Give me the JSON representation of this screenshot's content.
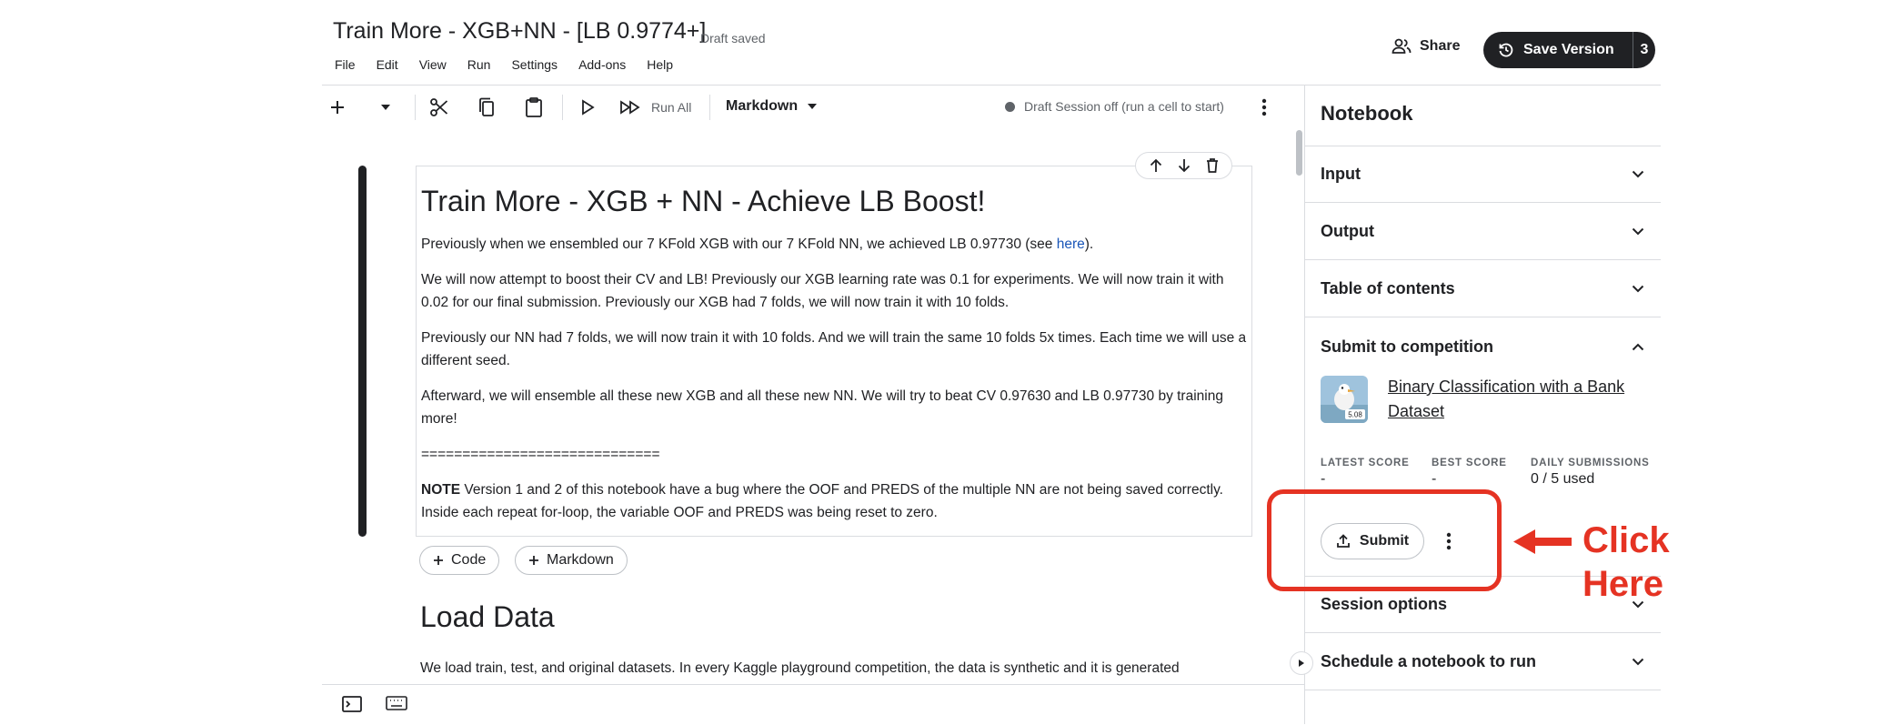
{
  "header": {
    "title": "Train More - XGB+NN - [LB 0.9774+]",
    "draft_status": "Draft saved",
    "menu": [
      "File",
      "Edit",
      "View",
      "Run",
      "Settings",
      "Add-ons",
      "Help"
    ],
    "share_label": "Share",
    "save_version_label": "Save Version",
    "save_version_count": "3"
  },
  "toolbar": {
    "run_all_label": "Run All",
    "cell_type": "Markdown",
    "session_status": "Draft Session off (run a cell to start)",
    "icons": [
      "plus-icon",
      "chevron-down-icon",
      "scissors-icon",
      "copy-icon",
      "paste-icon",
      "run-icon",
      "run-all-icon",
      "more-vert-icon"
    ]
  },
  "cell": {
    "heading": "Train More - XGB + NN - Achieve LB Boost!",
    "p1_before_link": "Previously when we ensembled our 7 KFold XGB with our 7 KFold NN, we achieved LB 0.97730 (see ",
    "p1_link": "here",
    "p1_after_link": ").",
    "p2": "We will now attempt to boost their CV and LB! Previously our XGB learning rate was 0.1 for experiments. We will now train it with 0.02 for our final submission. Previously our XGB had 7 folds, we will now train it with 10 folds.",
    "p3": "Previously our NN had 7 folds, we will now train it with 10 folds. And we will train the same 10 folds 5x times. Each time we will use a different seed.",
    "p4": "Afterward, we will ensemble all these new XGB and all these new NN. We will try to beat CV 0.97630 and LB 0.97730 by training more!",
    "separator": "=============================",
    "note_bold": "NOTE",
    "note_text": " Version 1 and 2 of this notebook have a bug where the OOF and PREDS of the multiple NN are not being saved correctly. Inside each repeat for-loop, the variable OOF and PREDS was being reset to zero."
  },
  "add_cell": {
    "code_label": "Code",
    "markdown_label": "Markdown"
  },
  "next_cell": {
    "heading": "Load Data",
    "text": "We load train, test, and original datasets. In every Kaggle playground competition, the data is synthetic and it is generated"
  },
  "panel": {
    "title": "Notebook",
    "sections": {
      "input": "Input",
      "output": "Output",
      "toc": "Table of contents",
      "submit": "Submit to competition",
      "session": "Session options",
      "schedule": "Schedule a notebook to run"
    },
    "competition": {
      "name": "Binary Classification with a Bank Dataset",
      "thumb_badge": "5.08"
    },
    "stats": {
      "latest_label": "LATEST SCORE",
      "latest_value": "-",
      "best_label": "BEST SCORE",
      "best_value": "-",
      "daily_label": "DAILY SUBMISSIONS",
      "daily_value": "0 / 5 used"
    },
    "submit_label": "Submit"
  },
  "annotation": {
    "line1": "Click",
    "line2": "Here",
    "color": "#e53323"
  }
}
